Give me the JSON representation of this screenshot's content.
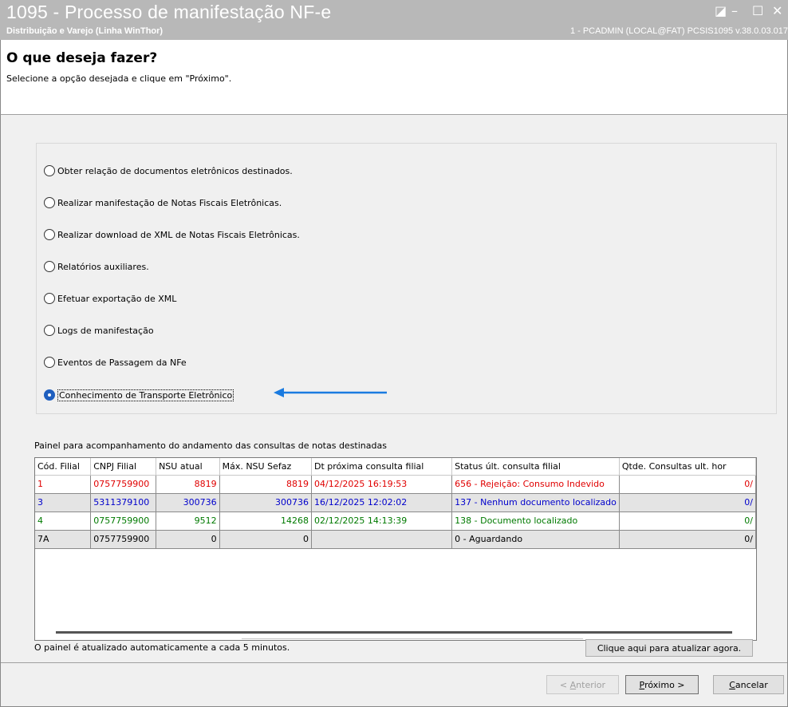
{
  "window": {
    "title": "1095 - Processo de manifestação NF-e",
    "subtitle": "Distribuição e Varejo (Linha WinThor)",
    "user_info": "1 - PCADMIN (LOCAL@FAT)   PCSIS1095  v.38.0.03.017",
    "controls": {
      "restore": "◪",
      "minimize": "–",
      "maximize": "☐",
      "close": "✕"
    }
  },
  "header": {
    "title": "O que deseja fazer?",
    "instruction": "Selecione a opção desejada e clique em \"Próximo\"."
  },
  "options": [
    {
      "label": "Obter relação de documentos eletrônicos destinados.",
      "selected": false
    },
    {
      "label": "Realizar manifestação de Notas Fiscais Eletrônicas.",
      "selected": false
    },
    {
      "label": "Realizar download de XML de Notas Fiscais Eletrônicas.",
      "selected": false
    },
    {
      "label": "Relatórios auxiliares.",
      "selected": false
    },
    {
      "label": "Efetuar exportação de XML",
      "selected": false
    },
    {
      "label": "Logs de manifestação",
      "selected": false
    },
    {
      "label": "Eventos de Passagem da NFe",
      "selected": false
    },
    {
      "label": "Conhecimento de Transporte Eletrônico",
      "selected": true
    }
  ],
  "annotation": {
    "arrow_color": "#1a7be0"
  },
  "panel": {
    "caption": "Painel para acompanhamento do andamento das consultas de notas destinadas",
    "columns": [
      "Cód. Filial",
      "CNPJ Filial",
      "NSU atual",
      "Máx. NSU Sefaz",
      "Dt próxima consulta filial",
      "Status últ. consulta filial",
      "Qtde. Consultas ult. hor"
    ],
    "rows": [
      {
        "color": "red",
        "cells": [
          "1",
          "0757759900",
          "8819",
          "8819",
          "04/12/2025 16:19:53",
          "656 - Rejeição: Consumo Indevido",
          "0/"
        ]
      },
      {
        "color": "blue",
        "cells": [
          "3",
          "5311379100",
          "300736",
          "300736",
          "16/12/2025 12:02:02",
          "137 - Nenhum documento localizado",
          "0/"
        ]
      },
      {
        "color": "green",
        "cells": [
          "4",
          "0757759900",
          "9512",
          "14268",
          "02/12/2025 14:13:39",
          "138 - Documento localizado",
          "0/"
        ]
      },
      {
        "color": "black",
        "cells": [
          "7A",
          "0757759900",
          "0",
          "0",
          "",
          "0 - Aguardando",
          "0/"
        ]
      }
    ],
    "footer_note": "O painel é atualizado automaticamente a cada 5 minutos.",
    "refresh_button": "Clique aqui para atualizar agora."
  },
  "buttons": {
    "back": {
      "prefix": "< ",
      "hotkey": "A",
      "rest": "nterior"
    },
    "next": {
      "hotkey": "P",
      "rest": "róximo >"
    },
    "cancel": {
      "hotkey": "C",
      "rest": "ancelar"
    }
  }
}
